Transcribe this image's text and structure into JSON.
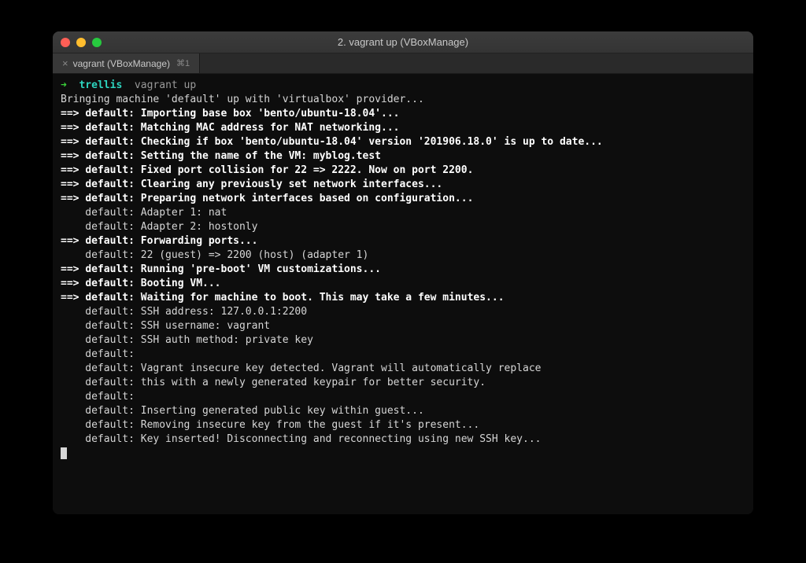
{
  "window": {
    "title": "2. vagrant up (VBoxManage)"
  },
  "tab": {
    "close": "×",
    "label": "vagrant (VBoxManage)",
    "shortcut": "⌘1"
  },
  "prompt": {
    "arrow": "➜",
    "dir": "trellis",
    "cmd": " vagrant up"
  },
  "lines": [
    {
      "type": "info",
      "text": "Bringing machine 'default' up with 'virtualbox' provider..."
    },
    {
      "type": "bold",
      "arrow": "==> ",
      "prefix": "default: ",
      "text": "Importing base box 'bento/ubuntu-18.04'..."
    },
    {
      "type": "bold",
      "arrow": "==> ",
      "prefix": "default: ",
      "text": "Matching MAC address for NAT networking..."
    },
    {
      "type": "bold",
      "arrow": "==> ",
      "prefix": "default: ",
      "text": "Checking if box 'bento/ubuntu-18.04' version '201906.18.0' is up to date..."
    },
    {
      "type": "bold",
      "arrow": "==> ",
      "prefix": "default: ",
      "text": "Setting the name of the VM: myblog.test"
    },
    {
      "type": "bold",
      "arrow": "==> ",
      "prefix": "default: ",
      "text": "Fixed port collision for 22 => 2222. Now on port 2200."
    },
    {
      "type": "bold",
      "arrow": "==> ",
      "prefix": "default: ",
      "text": "Clearing any previously set network interfaces..."
    },
    {
      "type": "bold",
      "arrow": "==> ",
      "prefix": "default: ",
      "text": "Preparing network interfaces based on configuration..."
    },
    {
      "type": "indent",
      "text": "    default: Adapter 1: nat"
    },
    {
      "type": "indent",
      "text": "    default: Adapter 2: hostonly"
    },
    {
      "type": "bold",
      "arrow": "==> ",
      "prefix": "default: ",
      "text": "Forwarding ports..."
    },
    {
      "type": "indent",
      "text": "    default: 22 (guest) => 2200 (host) (adapter 1)"
    },
    {
      "type": "bold",
      "arrow": "==> ",
      "prefix": "default: ",
      "text": "Running 'pre-boot' VM customizations..."
    },
    {
      "type": "bold",
      "arrow": "==> ",
      "prefix": "default: ",
      "text": "Booting VM..."
    },
    {
      "type": "bold",
      "arrow": "==> ",
      "prefix": "default: ",
      "text": "Waiting for machine to boot. This may take a few minutes..."
    },
    {
      "type": "indent",
      "text": "    default: SSH address: 127.0.0.1:2200"
    },
    {
      "type": "indent",
      "text": "    default: SSH username: vagrant"
    },
    {
      "type": "indent",
      "text": "    default: SSH auth method: private key"
    },
    {
      "type": "indent",
      "text": "    default: "
    },
    {
      "type": "indent",
      "text": "    default: Vagrant insecure key detected. Vagrant will automatically replace"
    },
    {
      "type": "indent",
      "text": "    default: this with a newly generated keypair for better security."
    },
    {
      "type": "indent",
      "text": "    default: "
    },
    {
      "type": "indent",
      "text": "    default: Inserting generated public key within guest..."
    },
    {
      "type": "indent",
      "text": "    default: Removing insecure key from the guest if it's present..."
    },
    {
      "type": "indent",
      "text": "    default: Key inserted! Disconnecting and reconnecting using new SSH key..."
    }
  ]
}
